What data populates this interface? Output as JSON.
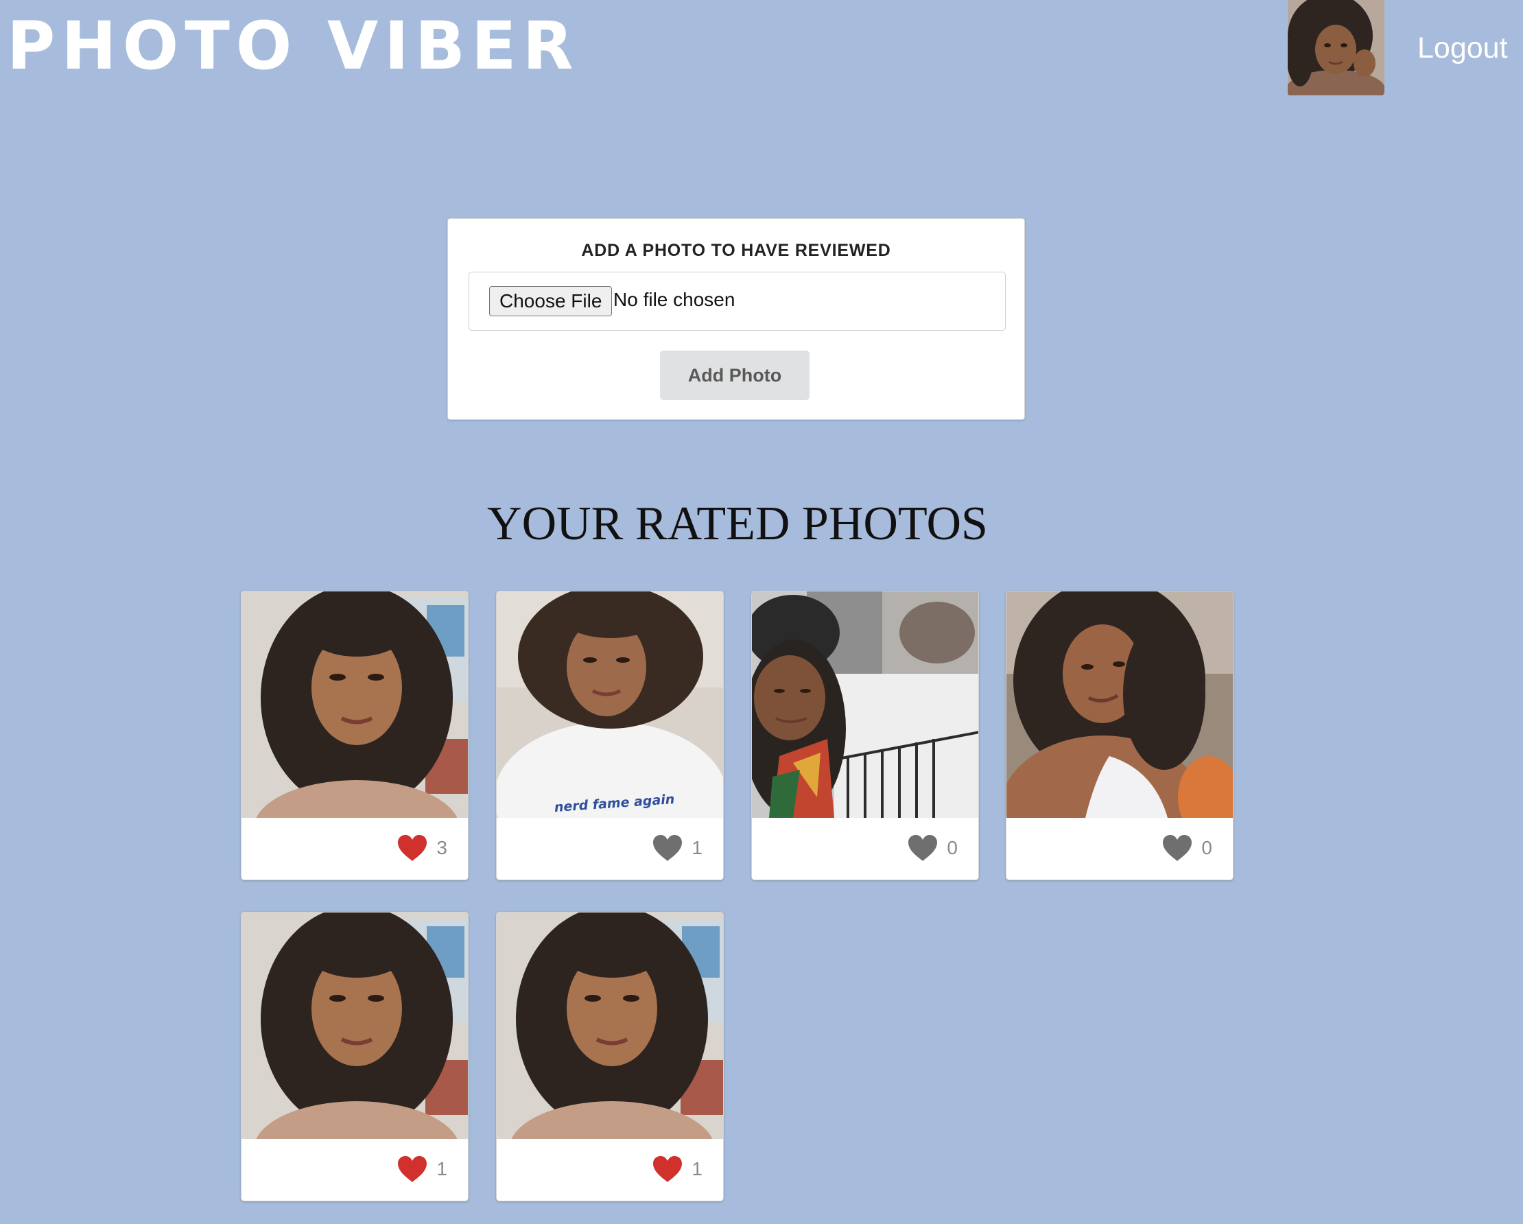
{
  "header": {
    "logo": "PHOTO VIBER",
    "logout": "Logout"
  },
  "upload": {
    "title": "ADD A PHOTO TO HAVE REVIEWED",
    "choose_file_label": "Choose File",
    "no_file_text": "No file chosen",
    "add_button_label": "Add Photo"
  },
  "gallery": {
    "heading": "YOUR RATED PHOTOS",
    "photos": [
      {
        "likes": "3",
        "liked": true,
        "scene": "closeup-indoor"
      },
      {
        "likes": "1",
        "liked": false,
        "scene": "white-tshirt",
        "shirt_text": "nerd fame again"
      },
      {
        "likes": "0",
        "liked": false,
        "scene": "snowy-street"
      },
      {
        "likes": "0",
        "liked": false,
        "scene": "curly-hair-outdoor"
      },
      {
        "likes": "1",
        "liked": true,
        "scene": "closeup-indoor"
      },
      {
        "likes": "1",
        "liked": true,
        "scene": "closeup-indoor"
      }
    ]
  },
  "colors": {
    "page_background": "#a7bcdc",
    "heart_liked": "#d0312d",
    "heart_unliked": "#6f6f6f"
  },
  "icons": {
    "like": "heart-icon"
  }
}
